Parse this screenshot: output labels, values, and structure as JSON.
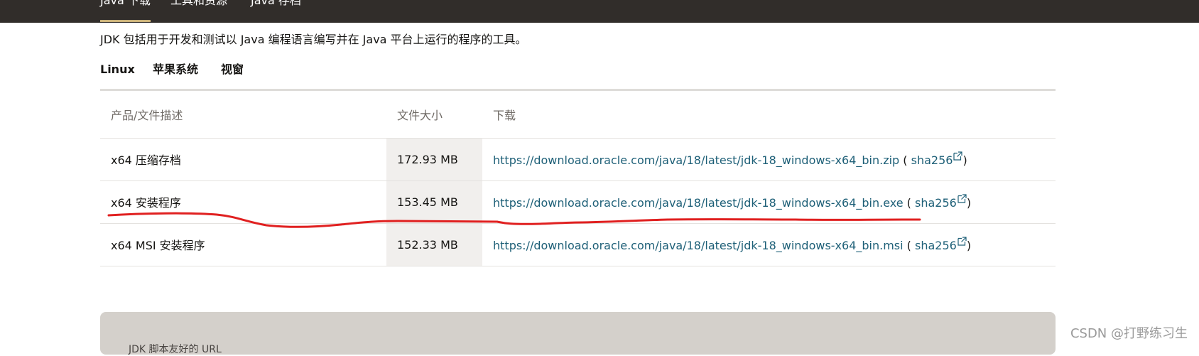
{
  "topnav": {
    "items": [
      {
        "label": "Java 下载",
        "active": true
      },
      {
        "label": "工具和资源",
        "active": false
      },
      {
        "label": "Java 存档",
        "active": false
      }
    ],
    "background": "#312d2a",
    "accent": "#ccb37a"
  },
  "description": "JDK 包括用于开发和测试以 Java 编程语言编写并在 Java 平台上运行的程序的工具。",
  "tabs": [
    {
      "label": "Linux",
      "active": false
    },
    {
      "label": "苹果系统",
      "active": false
    },
    {
      "label": "视窗",
      "active": true
    }
  ],
  "table": {
    "headers": [
      "产品/文件描述",
      "文件大小",
      "下载"
    ],
    "rows": [
      {
        "desc": "x64 压缩存档",
        "size": "172.93 MB",
        "url": "https://download.oracle.com/java/18/latest/jdk-18_windows-x64_bin.zip",
        "paren_open": " ( ",
        "sha": "sha256",
        "paren_close": ")"
      },
      {
        "desc": "x64 安装程序",
        "size": "153.45 MB",
        "url": "https://download.oracle.com/java/18/latest/jdk-18_windows-x64_bin.exe",
        "paren_open": " ( ",
        "sha": "sha256",
        "paren_close": ")"
      },
      {
        "desc": "x64 MSI 安装程序",
        "size": "152.33 MB",
        "url": "https://download.oracle.com/java/18/latest/jdk-18_windows-x64_bin.msi",
        "paren_open": " ( ",
        "sha": "sha256",
        "paren_close": ")"
      }
    ]
  },
  "bottom_box": {
    "partial_text": "JDK 脚本友好的 URL"
  },
  "watermark": "CSDN @打野练习生",
  "colors": {
    "link": "#1d5f77",
    "tab_accent": "#3e7c5f",
    "annotation": "#e02020"
  }
}
